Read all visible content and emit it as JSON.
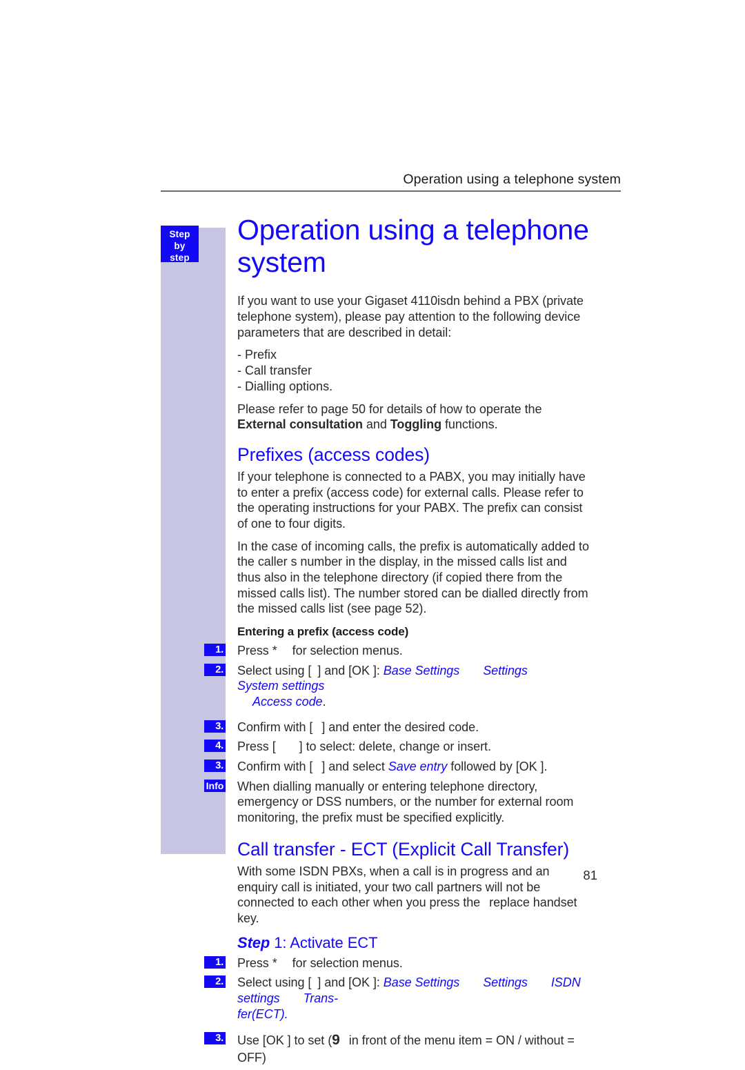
{
  "page": {
    "running_header": "Operation using a telephone system",
    "page_number": "81",
    "sidebar_tab": {
      "line1": "Step",
      "line2": "by",
      "line3": "step"
    },
    "accent_blue": "#1409f5",
    "sidebar_lavender": "#c6c5e2",
    "rule_grey": "#6b6b72"
  },
  "chapter": {
    "title": "Operation using a telephone system",
    "intro": "If you want to use your Gigaset 4110isdn behind a PBX (private telephone system), please pay attention to the following device parameters that are described in detail:",
    "parameter_list": [
      "- Prefix",
      "- Call transfer",
      "- Dialling options."
    ],
    "refer_note_pre": "Please refer to page 50 for details of how to operate the ",
    "refer_note_bold1": "External consultation",
    "refer_note_mid": " and ",
    "refer_note_bold2": "Toggling",
    "refer_note_post": " functions."
  },
  "prefixes": {
    "heading": "Prefixes (access codes)",
    "para1": "If your telephone is connected to a PABX, you may initially have to enter a prefix (access code) for external calls. Please refer to the operating instructions for your PABX. The prefix can consist of one to four digits.",
    "para2": "In the case of incoming calls, the prefix is automatically added to the caller s number in the display, in the missed calls list and thus also in the telephone directory (if copied there from the missed calls list). The number stored can be dialled directly from the missed calls list (see page 52).",
    "entering_heading": "Entering a prefix (access code)",
    "steps": [
      {
        "badge": "1.",
        "pre": "Press *",
        "post": "for selection menus."
      },
      {
        "badge": "2.",
        "pre": "Select using [",
        "mid": "] and [OK ]: ",
        "menu": [
          "Base Settings",
          "Settings",
          "System settings",
          "Access code"
        ],
        "tail": "."
      },
      {
        "badge": "3.",
        "pre": "Confirm with [",
        "post": "] and enter the desired code."
      },
      {
        "badge": "4.",
        "pre": "Press [",
        "post": "] to select: delete, change or insert."
      },
      {
        "badge": "3.",
        "pre": "Confirm with [",
        "mid": "] and select ",
        "menu_item": "Save entry",
        "post": " followed by [OK ]."
      }
    ],
    "info": {
      "badge": "Info",
      "text": "When dialling manually or entering telephone directory, emergency or DSS numbers, or the number for external room monitoring, the prefix must be specified explicitly."
    }
  },
  "call_transfer": {
    "heading": "Call transfer - ECT (Explicit Call Transfer)",
    "para1_a": "With some ISDN PBXs, when a call is in progress and an enquiry call is initiated, your two call partners will not be connected to each other when you press the",
    "para1_b": "replace handset",
    "para1_c": "key.",
    "step_heading_word": "Step",
    "step_heading_rest": " 1: Activate ECT",
    "steps": [
      {
        "badge": "1.",
        "pre": "Press *",
        "post": "for selection menus."
      },
      {
        "badge": "2.",
        "pre": "Select using [",
        "mid": "] and [OK ]: ",
        "menu": [
          "Base Settings",
          "Settings",
          "ISDN settings",
          "Trans-",
          "fer(ECT)"
        ],
        "tail": "."
      },
      {
        "badge": "3.",
        "pre": "Use [OK ] to set (",
        "glyph": "9",
        "post": "in front of the menu item = ON / without = OFF)"
      }
    ]
  }
}
